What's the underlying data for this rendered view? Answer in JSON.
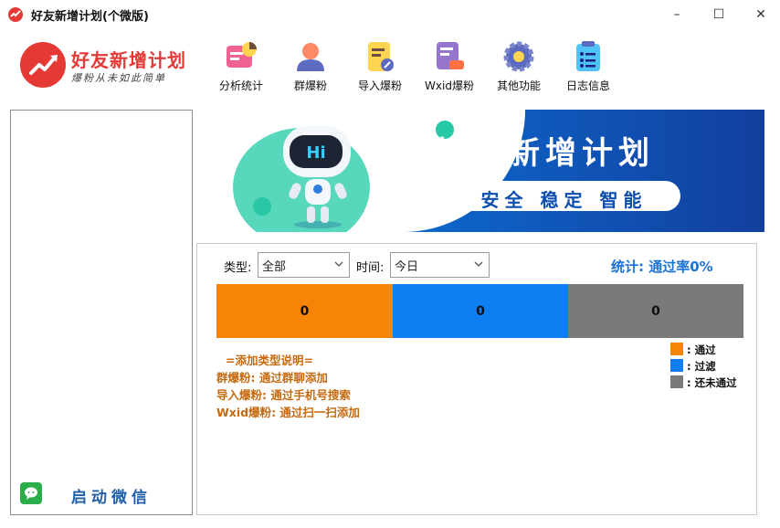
{
  "window": {
    "title": "好友新增计划(个微版)",
    "controls": {
      "minimize": "–",
      "maximize": "☐",
      "close": "✕"
    }
  },
  "logo": {
    "title": "好友新增计划",
    "slogan": "爆粉从未如此简单"
  },
  "toolbar": [
    {
      "label": "分析统计",
      "icon": "chart-icon"
    },
    {
      "label": "群爆粉",
      "icon": "user-icon"
    },
    {
      "label": "导入爆粉",
      "icon": "import-icon"
    },
    {
      "label": "Wxid爆粉",
      "icon": "id-card-icon"
    },
    {
      "label": "其他功能",
      "icon": "gear-icon"
    },
    {
      "label": "日志信息",
      "icon": "clipboard-icon"
    }
  ],
  "sidebar": {
    "launch_label": "启动微信"
  },
  "banner": {
    "robot_text": "Hi",
    "title": "好友新增计划",
    "subtitle": "安全 稳定 智能"
  },
  "filters": {
    "type_label": "类型:",
    "type_value": "全部",
    "time_label": "时间:",
    "time_value": "今日"
  },
  "stats": {
    "summary": "统计: 通过率0%",
    "bars": [
      {
        "value": "0",
        "color": "#f58407"
      },
      {
        "value": "0",
        "color": "#0d7ff0"
      },
      {
        "value": "0",
        "color": "#7a7a7a"
      }
    ]
  },
  "notes": {
    "heading": "=添加类型说明=",
    "lines": [
      "群爆粉: 通过群聊添加",
      "导入爆粉: 通过手机号搜索",
      "Wxid爆粉: 通过扫一扫添加"
    ]
  },
  "legend": [
    {
      "label": ": 通过",
      "color": "#f58407"
    },
    {
      "label": ": 过滤",
      "color": "#0d7ff0"
    },
    {
      "label": ": 还未通过",
      "color": "#7a7a7a"
    }
  ]
}
